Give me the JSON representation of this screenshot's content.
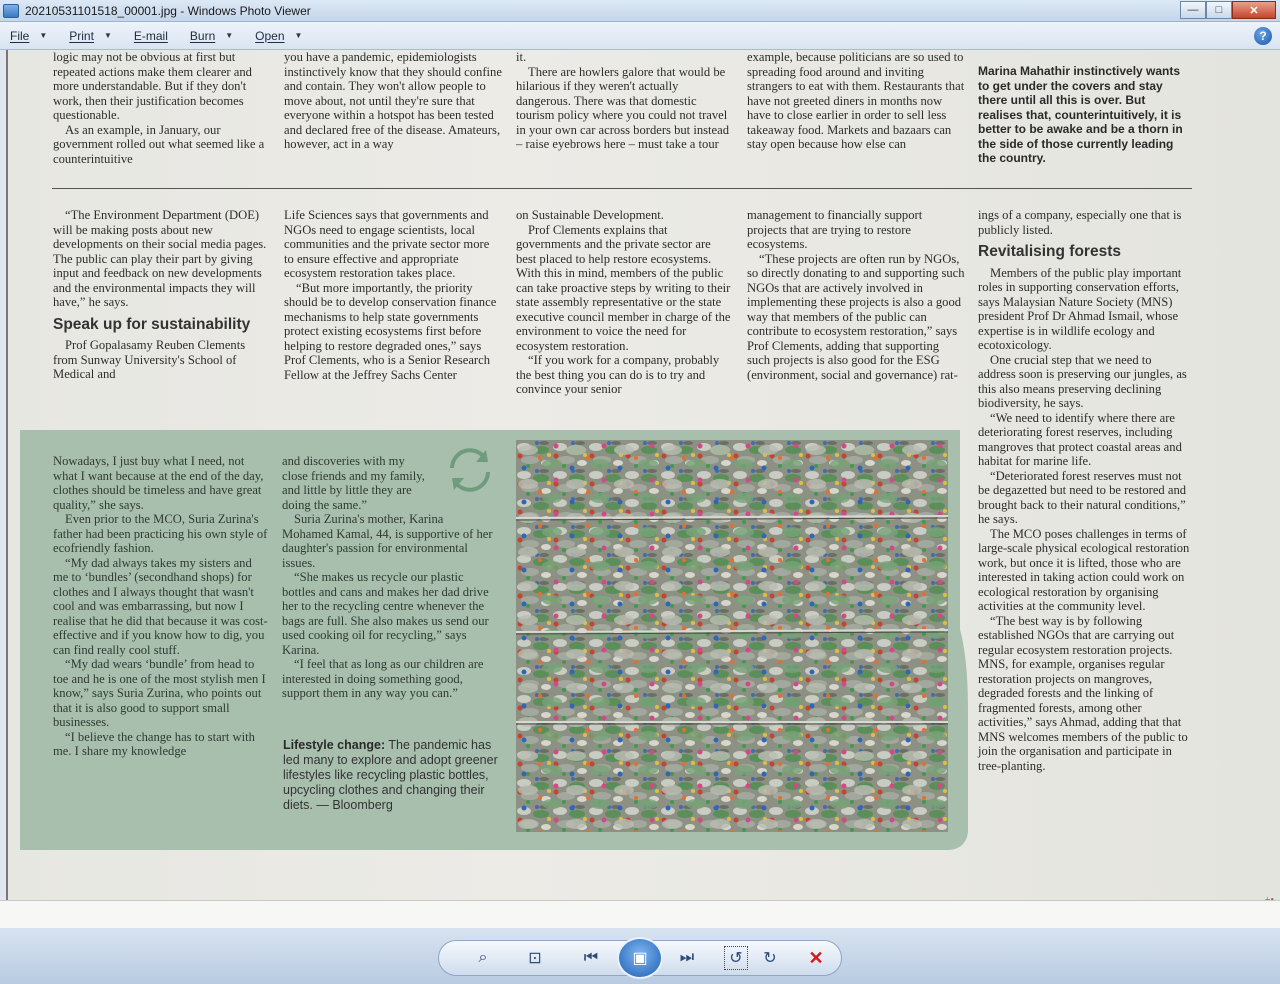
{
  "window": {
    "title": "20210531101518_00001.jpg - Windows Photo Viewer",
    "min_glyph": "—",
    "max_glyph": "□",
    "close_glyph": "✕"
  },
  "menu": {
    "file": "File",
    "print": "Print",
    "email": "E-mail",
    "burn": "Burn",
    "open": "Open",
    "help_glyph": "?"
  },
  "article": {
    "top_col1": "logic may not be obvious at first but repeated actions make them clearer and more understandable. But if they don't work, then their justification becomes questionable.",
    "top_col1b": "As an example, in January, our government rolled out what seemed like a counterintuitive",
    "top_col2": "you have a pandemic, epidemiologists instinctively know that they should confine and contain. They won't allow people to move about, not until they're sure that everyone within a hotspot has been tested and declared free of the disease. Amateurs, however, act in a way",
    "top_col3a": "it.",
    "top_col3b": "There are howlers galore that would be hilarious if they weren't actually dangerous. There was that domestic tourism policy where you could not travel in your own car across borders but instead – raise eyebrows here – must take a tour",
    "top_col4": "example, because politicians are so used to spreading food around and inviting strangers to eat with them. Restaurants that have not greeted diners in months now have to close earlier in order to sell less takeaway food. Markets and bazaars can stay open because how else can",
    "pullquote": "Marina Mahathir instinctively wants to get under the covers and stay there until all this is over. But realises that, counterintuitively, it is better to be awake and be a thorn in the side of those currently leading the country.",
    "mid_col1": "“The Environment Department (DOE) will be making posts about new developments on their social media pages. The public can play their part by giving input and feedback on new developments and the environmental impacts they will have,” he says.",
    "head_speak": "Speak up for sustainability",
    "mid_col1b": "Prof Gopalasamy Reuben Clements from Sunway University's School of Medical and",
    "mid_col2a": "Life Sciences says that governments and NGOs need to engage scientists, local communities and the private sector more to ensure effective and appropriate ecosystem restoration takes place.",
    "mid_col2b": "“But more importantly, the priority should be to develop conservation finance mechanisms to help state governments protect existing ecosystems first before helping to restore degraded ones,” says Prof Clements, who is a Senior Research Fellow at the Jeffrey Sachs Center",
    "mid_col3a": "on Sustainable Development.",
    "mid_col3b": "Prof Clements explains that governments and the private sector are best placed to help restore ecosystems. With this in mind, members of the public can take proactive steps by writing to their state assembly representative or the state executive council member in charge of the environment to voice the need for ecosystem restoration.",
    "mid_col3c": "“If you work for a company, probably the best thing you can do is to try and convince your senior",
    "mid_col4a": "management to financially support projects that are trying to restore ecosystems.",
    "mid_col4b": "“These projects are often run by NGOs, so directly donating to and supporting such NGOs that are actively involved in implementing these projects is also a good way that members of the public can contribute to ecosystem restoration,” says Prof Clements, adding that supporting such projects is also good for the ESG (environment, social and governance) rat-",
    "right_a": "ings of a company, especially one that is publicly listed.",
    "head_forests": "Revitalising forests",
    "right_b": "Members of the public play important roles in supporting conservation efforts, says Malaysian Nature Society (MNS) president Prof Dr Ahmad Ismail, whose expertise is in wildlife ecology and ecotoxicology.",
    "right_c": "One crucial step that we need to address soon is preserving our jungles, as this also means preserving declining biodiversity, he says.",
    "right_d": "“We need to identify where there are deteriorating forest reserves, including mangroves that protect coastal areas and habitat for marine life.",
    "right_e": "“Deteriorated forest reserves must not be degazetted but need to be restored and brought back to their natural conditions,” he says.",
    "right_f": "The MCO poses challenges in terms of large-scale physical ecological restoration work, but once it is lifted, those who are interested in taking action could work on ecological restoration by organising activities at the community level.",
    "right_g": "“The best way is by following established NGOs that are carrying out regular ecosystem restoration projects. MNS, for example, organises regular restoration projects on mangroves, degraded forests and the linking of fragmented forests, among other activities,” says Ahmad, adding that that MNS welcomes members of the public to join the organisation and participate in tree-planting.",
    "green_col1a": "Nowadays, I just buy what I need, not what I want because at the end of the day, clothes should be timeless and have great quality,” she says.",
    "green_col1b": "Even prior to the MCO, Suria Zurina's father had been practicing his own style of ecofriendly fashion.",
    "green_col1c": "“My dad always takes my sisters and me to ‘bundles’ (secondhand shops) for clothes and I always thought that wasn't cool and was embarrassing, but now I realise that he did that because it was cost-effective and if you know how to dig, you can find really cool stuff.",
    "green_col1d": "“My dad wears ‘bundle’ from head to toe and he is one of the most stylish men I know,” says Suria Zurina, who points out that it is also good to support small businesses.",
    "green_col1e": "“I believe the change has to start with me. I share my knowledge",
    "green_col2a": "and discoveries with my close friends and my family, and little by little they are doing the same.”",
    "green_col2b": "Suria Zurina's mother, Karina Mohamed Kamal, 44, is supportive of her daughter's passion for environmental issues.",
    "green_col2c": "“She makes us recycle our plastic bottles and cans and makes her dad drive her to the recycling centre whenever the bags are full. She also makes us send our used cooking oil for recycling,” says Karina.",
    "green_col2d": "“I feel that as long as our children are interested in doing something good, support them in any way you can.”",
    "caption_bold": "Lifestyle change:",
    "caption_text": " The pandemic has led many to explore and adopt greener lifestyles like recycling plastic bottles, upcycling clothes and changing their diets. — Bloomberg"
  },
  "toolbar": {
    "zoom_glyph": "⌕",
    "fit_glyph": "⊡",
    "prev_glyph": "⏮",
    "slideshow_glyph": "▣",
    "next_glyph": "⏭",
    "rotate_left_glyph": "↺",
    "rotate_right_glyph": "↻",
    "delete_glyph": "✕"
  },
  "colors": {
    "green_box": "#a8bfae",
    "accent": "#1e5fb5"
  }
}
